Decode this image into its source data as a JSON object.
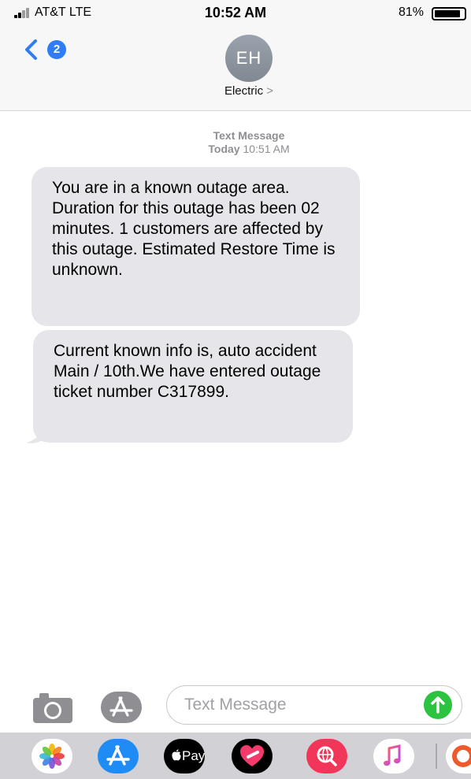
{
  "status_bar": {
    "carrier": "AT&T  LTE",
    "time": "10:52 AM",
    "battery": "81%"
  },
  "header": {
    "back_badge": "2",
    "avatar_initials": "EH",
    "contact_name": "Electric",
    "contact_chevron": ">"
  },
  "conversation": {
    "service_label": "Text Message",
    "day_label": "Today",
    "time_label": "10:51 AM",
    "messages": [
      " You are in a known outage area. Duration for this outage has been 02 minutes. 1 customers are affected by this outage. Estimated Restore Time is unknown.",
      " Current known info is, auto accident Main / 10th.We have entered outage ticket number C317899."
    ]
  },
  "composer": {
    "placeholder": "Text Message"
  },
  "app_drawer": {
    "apple_pay_label": "Pay"
  },
  "colors": {
    "accent": "#2e7cf6",
    "bubble": "#e5e5ea",
    "send": "#2bc340",
    "drawer": "#d1d1d6"
  }
}
